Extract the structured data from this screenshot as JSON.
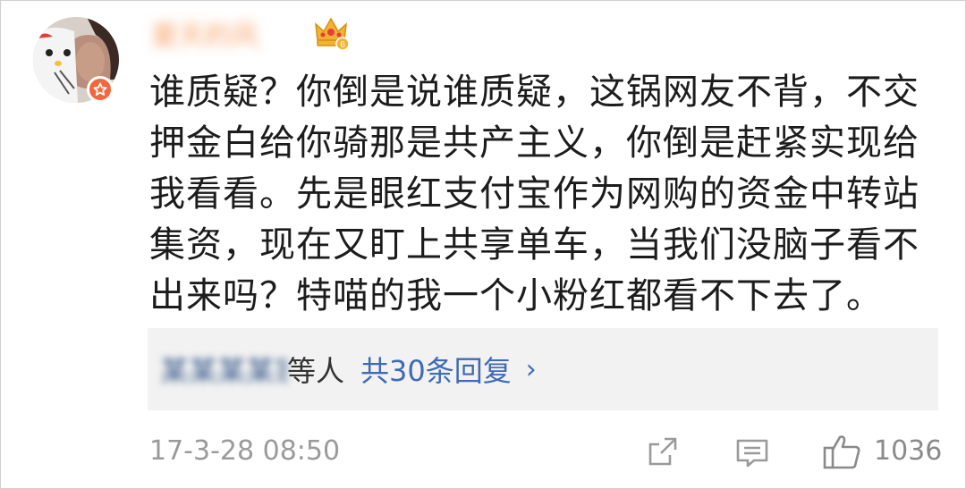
{
  "user": {
    "name": "夏天的风",
    "badge_icon": "crown-icon",
    "badge_level": "6",
    "verified_icon": "star-icon"
  },
  "comment": {
    "text": "谁质疑？你倒是说谁质疑，这锅网友不背，不交\n押金白给你骑那是共产主义，你倒是赶紧实现给\n我看看。先是眼红支付宝作为网购的资金中转站\n集资，现在又盯上共享单车，当我们没脑子看不\n出来吗？特喵的我一个小粉红都看不下去了。"
  },
  "replies": {
    "users": "某某某某家",
    "suffix": "等人",
    "count_label": "共30条回复",
    "arrow": "›"
  },
  "footer": {
    "timestamp": "17-3-28 08:50",
    "like_count": "1036"
  },
  "colors": {
    "accent_blue": "#3f6bb5",
    "badge_orange": "#f2673b",
    "crown_gold": "#f2b233"
  }
}
